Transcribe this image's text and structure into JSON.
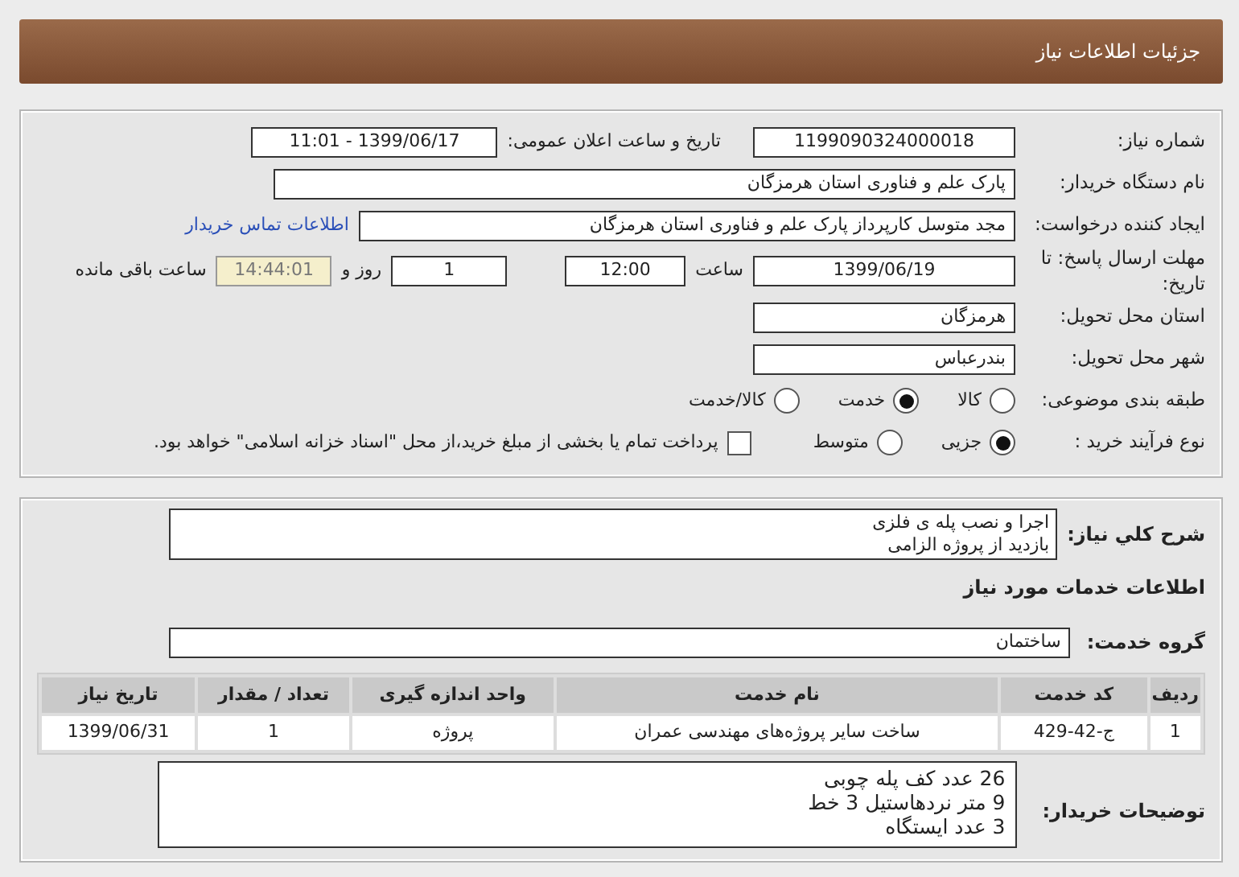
{
  "page_title": "جزئیات اطلاعات نیاز",
  "need_number": {
    "label": "شماره نیاز:",
    "value": "1199090324000018"
  },
  "announce": {
    "label": "تاریخ و ساعت اعلان عمومی:",
    "value": "1399/06/17 - 11:01"
  },
  "buyer_org": {
    "label": "نام دستگاه خریدار:",
    "value": "پارک علم و فناوری استان هرمزگان"
  },
  "creator": {
    "label": "ایجاد کننده درخواست:",
    "value": "مجد متوسل کارپرداز پارک علم و فناوری استان هرمزگان",
    "link": "اطلاعات تماس خریدار"
  },
  "deadline": {
    "label": "مهلت ارسال پاسخ: تا تاریخ:",
    "date": "1399/06/19",
    "time_label": "ساعت",
    "time": "12:00",
    "days": "1",
    "days_label": "روز و",
    "remaining": "14:44:01",
    "remaining_label": "ساعت باقی مانده"
  },
  "province": {
    "label": "استان محل تحویل:",
    "value": "هرمزگان"
  },
  "city": {
    "label": "شهر محل تحویل:",
    "value": "بندرعباس"
  },
  "category": {
    "label": "طبقه بندی موضوعی:",
    "options": [
      {
        "label": "کالا",
        "selected": false
      },
      {
        "label": "خدمت",
        "selected": true
      },
      {
        "label": "کالا/خدمت",
        "selected": false
      }
    ]
  },
  "process": {
    "label": "نوع فرآیند خرید :",
    "options": [
      {
        "label": "جزیی",
        "selected": true
      },
      {
        "label": "متوسط",
        "selected": false
      }
    ],
    "payment": {
      "checked": false,
      "text": "پرداخت تمام یا بخشی از مبلغ خرید،از محل \"اسناد خزانه اسلامی\" خواهد بود."
    }
  },
  "description": {
    "label": "شرح کلي نياز:",
    "lines": [
      "اجرا و نصب پله ی فلزی",
      "بازدید از پروژه الزامی"
    ]
  },
  "services_heading": "اطلاعات خدمات مورد نیاز",
  "service_group": {
    "label": "گروه خدمت:",
    "value": "ساختمان"
  },
  "table": {
    "columns": [
      "ردیف",
      "کد خدمت",
      "نام خدمت",
      "واحد اندازه گیری",
      "تعداد / مقدار",
      "تاریخ نیاز"
    ],
    "rows": [
      [
        "1",
        "ج-42-429",
        "ساخت سایر پروژه‌های مهندسی عمران",
        "پروژه",
        "1",
        "1399/06/31"
      ]
    ]
  },
  "buyer_notes": {
    "label": "توضیحات خریدار:",
    "lines": [
      "26 عدد کف پله چوبی",
      "9 متر نردهاستیل 3 خط",
      "3 عدد ایستگاه"
    ]
  }
}
